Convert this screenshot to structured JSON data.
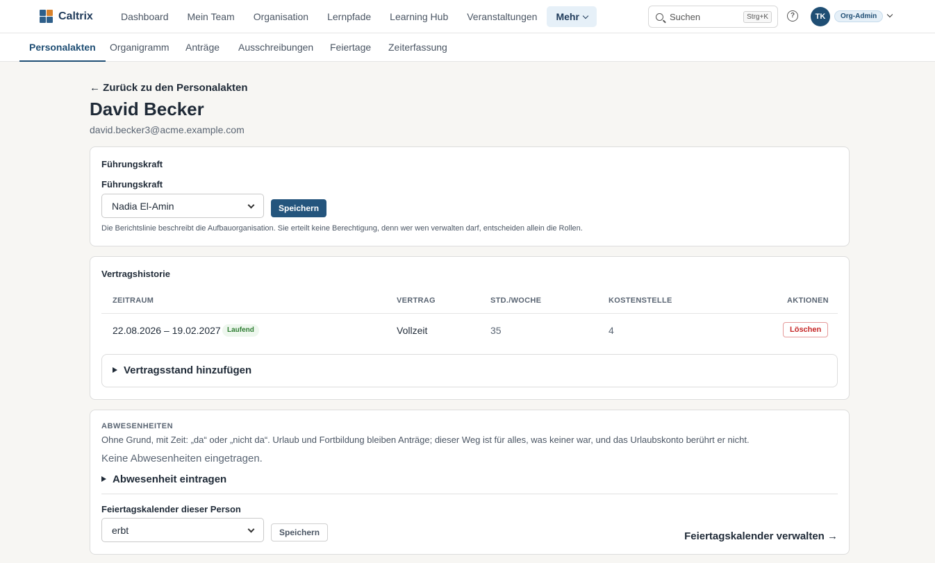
{
  "app": {
    "name": "Caltrix",
    "brand_colors": [
      "#2e5f8a",
      "#d9822b",
      "#2e5f8a",
      "#2e5f8a"
    ]
  },
  "topnav": {
    "items": [
      "Dashboard",
      "Mein Team",
      "Organisation",
      "Lernpfade",
      "Learning Hub",
      "Veranstaltungen"
    ],
    "more_label": "Mehr"
  },
  "search": {
    "placeholder": "Suchen",
    "shortcut": "Strg+K"
  },
  "help": {
    "glyph": "?"
  },
  "user": {
    "initials": "TK",
    "role": "Org-Admin"
  },
  "subnav": {
    "items": [
      "Personalakten",
      "Organigramm",
      "Anträge",
      "Ausschreibungen",
      "Feiertage",
      "Zeiterfassung"
    ],
    "active_index": 0
  },
  "page": {
    "back_link": "← Zurück zu den Personalakten",
    "title": "David Becker",
    "email": "david.becker3@acme.example.com"
  },
  "manager_card": {
    "title": "Führungskraft",
    "field_label": "Führungskraft",
    "selected": "Nadia El-Amin",
    "save_label": "Speichern",
    "hint": "Die Berichtslinie beschreibt die Aufbauorganisation. Sie erteilt keine Berechtigung, denn wer wen verwalten darf, entscheiden allein die Rollen."
  },
  "contract_card": {
    "title": "Vertragshistorie",
    "columns": [
      "ZEITRAUM",
      "VERTRAG",
      "STD./WOCHE",
      "KOSTENSTELLE",
      "AKTIONEN"
    ],
    "rows": [
      {
        "period": "22.08.2026 – 19.02.2027",
        "status": "Laufend",
        "contract": "Vollzeit",
        "hours": "35",
        "cost_center": "4",
        "action": "Löschen"
      }
    ],
    "add_label": "Vertragsstand hinzufügen"
  },
  "absence_card": {
    "kicker": "ABWESENHEITEN",
    "description": "Ohne Grund, mit Zeit: „da“ oder „nicht da“. Urlaub und Fortbildung bleiben Anträge; dieser Weg ist für alles, was keiner war, und das Urlaubskonto berührt er nicht.",
    "empty": "Keine Abwesenheiten eingetragen.",
    "add_label": "Abwesenheit eintragen",
    "holiday_label": "Feiertagskalender dieser Person",
    "holiday_selected": "erbt",
    "save_label": "Speichern",
    "manage_link": "Feiertagskalender verwalten →"
  }
}
